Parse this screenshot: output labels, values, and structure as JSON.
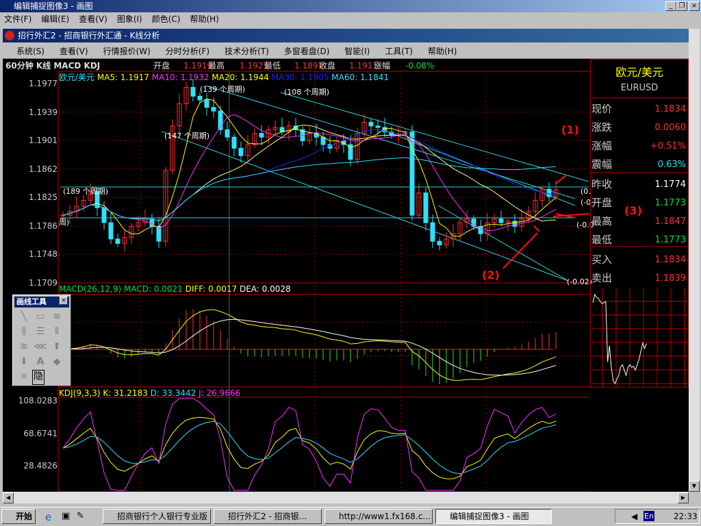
{
  "window": {
    "title": "编辑捕捉图像3 - 画图",
    "menu": [
      "文件(F)",
      "编辑(E)",
      "查看(V)",
      "图象(I)",
      "颜色(C)",
      "帮助(H)"
    ]
  },
  "mdi": {
    "title": "招行外汇2 - 招商银行外汇通 - K线分析"
  },
  "app_menu": [
    "系统(S)",
    "查看(V)",
    "行情报价(W)",
    "分时分析(F)",
    "技术分析(T)",
    "多窗看盘(D)",
    "智能(I)",
    "工具(T)",
    "帮助(H)"
  ],
  "info": {
    "period": "60分钟 K线 MACD KDJ",
    "open_label": "开盘",
    "open": "1.1919",
    "high_label": "最高",
    "high": "1.1925",
    "low_label": "最低",
    "low": "1.1891",
    "close_label": "收盘",
    "close": "1.1911",
    "change_label": "涨幅",
    "change": "-0.08%"
  },
  "ma_legend": {
    "symbol": "欧元/美元",
    "ma5": "MA5: 1.1917",
    "ma10": "MA10: 1.1932",
    "ma20": "MA20: 1.1944",
    "ma30": "MA30: 1.1905",
    "ma60": "MA60: 1.1841"
  },
  "macd_legend": {
    "name": "MACD(26,12,9)",
    "macd": "MACD: 0.0021",
    "diff": "DIFF: 0.0017",
    "dea": "DEA: 0.0028"
  },
  "kdj_legend": {
    "name": "KDJ(9,3,3)",
    "k": "K: 31.2183",
    "d": "D: 33.3442",
    "j": "J: 26.9666"
  },
  "chart_annotations": {
    "p189": "(189 个周期)",
    "p147": "(147 个周期)",
    "p139": "(139 个周期)",
    "p108": "(108 个周期)",
    "r1": "(0.",
    "r2": "(-0",
    "r3": "(-0.0",
    "r4": "(-0.02)",
    "h1": "(1)",
    "h2": "(2)",
    "h3": "(3)",
    "left_cut": "周)"
  },
  "chart_data": [
    {
      "type": "candlestick",
      "title": "欧元/美元 60分钟",
      "ylim": [
        1.1709,
        1.1977
      ],
      "yticks": [
        "1.1977",
        "1.1939",
        "1.1901",
        "1.1862",
        "1.1825",
        "1.1786",
        "1.1748",
        "1.1709"
      ],
      "closes": [
        1.18,
        1.1805,
        1.1812,
        1.182,
        1.1832,
        1.181,
        1.179,
        1.1768,
        1.1762,
        1.177,
        1.1785,
        1.179,
        1.1795,
        1.1785,
        1.1765,
        1.186,
        1.192,
        1.195,
        1.1972,
        1.196,
        1.1955,
        1.1945,
        1.194,
        1.1915,
        1.1905,
        1.189,
        1.188,
        1.1895,
        1.191,
        1.1905,
        1.1915,
        1.1918,
        1.1912,
        1.192,
        1.1915,
        1.19,
        1.191,
        1.1905,
        1.1895,
        1.189,
        1.19,
        1.1895,
        1.1875,
        1.191,
        1.1925,
        1.192,
        1.1918,
        1.1912,
        1.1908,
        1.191,
        1.1912,
        1.18,
        1.183,
        1.179,
        1.1765,
        1.176,
        1.1768,
        1.1775,
        1.179,
        1.1795,
        1.1785,
        1.1775,
        1.179,
        1.1795,
        1.179,
        1.1792,
        1.1785,
        1.1795,
        1.1805,
        1.182,
        1.1835,
        1.1825,
        1.1834
      ],
      "ma_periods": [
        5,
        10,
        20,
        30,
        60
      ]
    },
    {
      "type": "line",
      "title": "MACD(26,12,9)",
      "series": [
        "DIFF",
        "DEA",
        "MACD"
      ]
    },
    {
      "type": "line",
      "title": "KDJ(9,3,3)",
      "yticks": [
        "108.0283",
        "68.6741",
        "28.4826"
      ],
      "ylim": [
        28.4826,
        108.0283
      ]
    }
  ],
  "colors": {
    "up": "#ff3030",
    "down": "#30e0ff",
    "ma5": "#ffff00",
    "ma10": "#ff30ff",
    "ma20": "#ffff80",
    "ma30": "#2020ff",
    "ma60": "#30e0ff"
  },
  "quote": {
    "name": "欧元/美元",
    "code": "EURUSD",
    "rows": [
      {
        "label": "现价",
        "value": "1.1834",
        "color": "red"
      },
      {
        "label": "涨跌",
        "value": "0.0060",
        "color": "red"
      },
      {
        "label": "涨幅",
        "value": "+0.51%",
        "color": "red"
      },
      {
        "label": "震幅",
        "value": "0.63%",
        "color": "cyan"
      },
      {
        "label": "昨收",
        "value": "1.1774",
        "color": "white"
      },
      {
        "label": "开盘",
        "value": "1.1773",
        "color": "green"
      },
      {
        "label": "最高",
        "value": "1.1847",
        "color": "red"
      },
      {
        "label": "最低",
        "value": "1.1773",
        "color": "green"
      },
      {
        "label": "买入",
        "value": "1.1834",
        "color": "red"
      },
      {
        "label": "卖出",
        "value": "1.1839",
        "color": "red"
      }
    ]
  },
  "palette": {
    "title": "画线工具",
    "hide": "隐"
  },
  "taskbar": {
    "start": "开始",
    "tasks": [
      "招商银行个人银行专业版",
      "招行外汇2 - 招商银...",
      "http://www1.fx168.c...",
      "编辑捕捉图像3 - 画图"
    ],
    "clock": "22:33",
    "ime": "En"
  }
}
